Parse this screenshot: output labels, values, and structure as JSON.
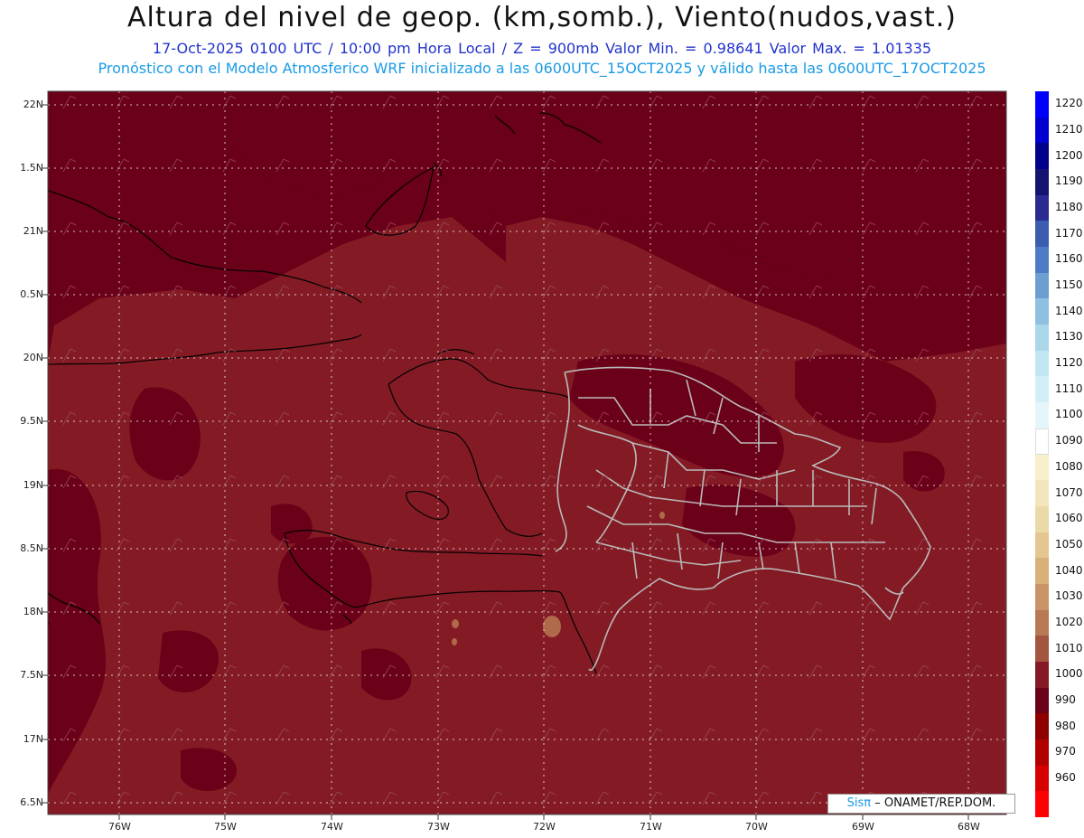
{
  "header": {
    "title": "Altura del nivel de geop. (km,somb.), Viento(nudos,vast.)",
    "subtitle_line1": "17-Oct-2025  0100 UTC / 10:00 pm Hora Local / Z = 900mb    Valor Min. = 0.98641   Valor Max. = 1.01335",
    "subtitle_line2": "Pronóstico con el Modelo Atmosferico WRF inicializado a las 0600UTC_15OCT2025 y válido hasta las  0600UTC_17OCT2025"
  },
  "axes": {
    "lat_labels": [
      "22N",
      "1.5N",
      "21N",
      "0.5N",
      "20N",
      "9.5N",
      "19N",
      "8.5N",
      "18N",
      "7.5N",
      "17N",
      "6.5N"
    ],
    "lon_labels": [
      "76W",
      "75W",
      "74W",
      "73W",
      "72W",
      "71W",
      "70W",
      "69W",
      "68W"
    ]
  },
  "colors": {
    "field_dark": "#6b0019",
    "field_light": "#841b24",
    "field_tan": "#b06a4a",
    "grid": "#ffffff",
    "coast": "#000000",
    "dr_boundaries": "#b9b9b9"
  },
  "legend": {
    "items": [
      {
        "label": "1220",
        "color": "#0000ff"
      },
      {
        "label": "1210",
        "color": "#0000d0"
      },
      {
        "label": "1200",
        "color": "#00008a"
      },
      {
        "label": "1190",
        "color": "#141470"
      },
      {
        "label": "1180",
        "color": "#2a2a90"
      },
      {
        "label": "1170",
        "color": "#3c5cb0"
      },
      {
        "label": "1160",
        "color": "#4d7cc4"
      },
      {
        "label": "1150",
        "color": "#6c9fd0"
      },
      {
        "label": "1140",
        "color": "#8fc0e0"
      },
      {
        "label": "1130",
        "color": "#aad8ea"
      },
      {
        "label": "1120",
        "color": "#c0e6f2"
      },
      {
        "label": "1110",
        "color": "#d2eef6"
      },
      {
        "label": "1100",
        "color": "#e4f6fa"
      },
      {
        "label": "1090",
        "color": "#ffffff"
      },
      {
        "label": "1080",
        "color": "#f8f0cc"
      },
      {
        "label": "1070",
        "color": "#f3e6bc"
      },
      {
        "label": "1060",
        "color": "#ecd9a8"
      },
      {
        "label": "1050",
        "color": "#e4c790"
      },
      {
        "label": "1040",
        "color": "#d8b07a"
      },
      {
        "label": "1030",
        "color": "#c99566"
      },
      {
        "label": "1020",
        "color": "#b87a55"
      },
      {
        "label": "1010",
        "color": "#a35540"
      },
      {
        "label": "1000",
        "color": "#841b24"
      },
      {
        "label": "990",
        "color": "#6b0019"
      },
      {
        "label": "980",
        "color": "#8e0000"
      },
      {
        "label": "970",
        "color": "#b20000"
      },
      {
        "label": "960",
        "color": "#d60000"
      },
      {
        "label": "",
        "color": "#ff0000"
      }
    ]
  },
  "credit": {
    "logo_text": "Sisπ",
    "org_text": "– ONAMET/REP.DOM."
  }
}
